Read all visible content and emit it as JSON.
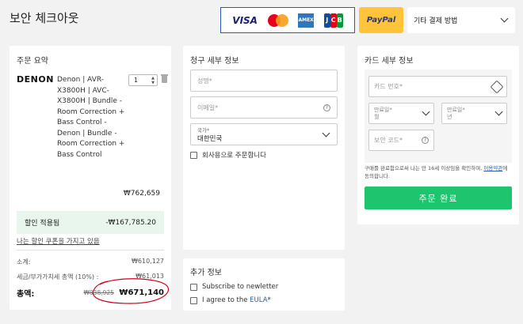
{
  "page": {
    "title": "보안 체크아웃"
  },
  "payment": {
    "card_brands": [
      "VISA",
      "Mastercard",
      "AMEX",
      "JCB"
    ],
    "visa_label": "VISA",
    "amex_label": "AMEX",
    "jcb_letters": [
      "J",
      "C",
      "B"
    ],
    "paypal_label": "PayPal",
    "other_method_label": "기타 결제 방법"
  },
  "order": {
    "title": "주문 요약",
    "brand": "DENON",
    "product_name": "Denon | AVR-X3800H | AVC-X3800H | Bundle - Room Correction + Bass Control - Denon | Bundle - Room Correction + Bass Control",
    "quantity": "1",
    "product_price": "₩762,659",
    "discount_label": "할인 적용됨",
    "discount_value": "-₩167,785.20",
    "coupon_link": "나는 할인 쿠폰을 가지고 있음",
    "subtotal_label": "소계:",
    "subtotal_value": "₩610,127",
    "tax_label": "세금/부가가치세 총액 (10%) :",
    "tax_value": "₩61,013",
    "total_label": "총액:",
    "total_original": "₩838,925",
    "total_value": "₩671,140"
  },
  "billing": {
    "title": "청구 세부 정보",
    "name_placeholder": "성명*",
    "email_placeholder": "이메일*",
    "country_label": "국가*",
    "country_value": "대한민국",
    "company_checkbox": "회사용으로 주문합니다"
  },
  "additional": {
    "title": "추가 정보",
    "newsletter": "Subscribe to newletter",
    "eula_prefix": "I agree to the ",
    "eula_link": "EULA",
    "eula_suffix": "*"
  },
  "card": {
    "title": "카드 세부 정보",
    "card_number_placeholder": "카드 번호*",
    "expiry_month_label": "만료일*",
    "expiry_month_unit": "월",
    "expiry_year_label": "만료일*",
    "expiry_year_unit": "년",
    "cvc_placeholder": "보안 코드*",
    "terms_text": "구매를 완료함으로써 나는 만 16세 이상임을 확인하며, ",
    "terms_link": "이용약관",
    "terms_suffix": "에 동의합니다.",
    "complete_button": "주문 완료"
  },
  "colors": {
    "accent_green": "#1fc46e",
    "paypal_yellow": "#ffc439",
    "discount_bg": "#e9f6ed",
    "link_blue": "#2a5bb8",
    "annotation_red": "#d0021b"
  }
}
